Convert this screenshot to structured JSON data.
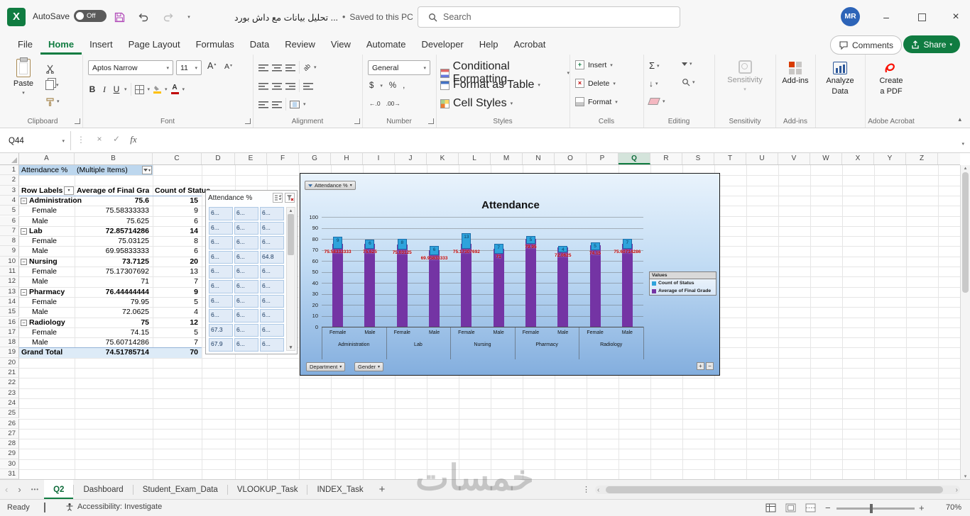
{
  "titlebar": {
    "autosave_label": "AutoSave",
    "autosave_state": "Off",
    "doc_title": "تحليل بيانات مع داش بورد ...",
    "saved_status": "Saved to this PC",
    "search_placeholder": "Search",
    "avatar": "MR"
  },
  "ribbon_tabs": {
    "items": [
      "File",
      "Home",
      "Insert",
      "Page Layout",
      "Formulas",
      "Data",
      "Review",
      "View",
      "Automate",
      "Developer",
      "Help",
      "Acrobat"
    ],
    "active": "Home",
    "comments_label": "Comments",
    "share_label": "Share"
  },
  "ribbon": {
    "paste_label": "Paste",
    "font_name": "Aptos Narrow",
    "font_size": "11",
    "number_format": "General",
    "styles_buttons": [
      "Conditional Formatting",
      "Format as Table",
      "Cell Styles"
    ],
    "cells_buttons": [
      "Insert",
      "Delete",
      "Format"
    ],
    "big_buttons": {
      "sensitivity": "Sensitivity",
      "addins": "Add-ins",
      "analyze_line1": "Analyze",
      "analyze_line2": "Data",
      "pdf_line1": "Create",
      "pdf_line2": "a PDF"
    },
    "group_labels": [
      "Clipboard",
      "Font",
      "Alignment",
      "Number",
      "Styles",
      "Cells",
      "Editing",
      "Sensitivity",
      "Add-ins",
      "Adobe Acrobat"
    ]
  },
  "formula_bar": {
    "name_box": "Q44",
    "fx_label": "fx",
    "value": ""
  },
  "columns": {
    "letters": [
      "A",
      "B",
      "C",
      "D",
      "E",
      "F",
      "G",
      "H",
      "I",
      "J",
      "K",
      "L",
      "M",
      "N",
      "O",
      "P",
      "Q",
      "R",
      "S",
      "T",
      "U",
      "V",
      "W",
      "X",
      "Y",
      "Z"
    ],
    "selected": "Q"
  },
  "rows": {
    "count": 31
  },
  "pivot": {
    "filter_label": "Attendance %",
    "filter_value": "(Multiple Items)",
    "headers": [
      "Row Labels",
      "Average of Final Grade",
      "Count of Status"
    ],
    "rows": [
      {
        "r": 4,
        "label": "Administration",
        "avg": "75.6",
        "count": "15",
        "bold": true,
        "btn": true
      },
      {
        "r": 5,
        "label": "Female",
        "avg": "75.58333333",
        "count": "9"
      },
      {
        "r": 6,
        "label": "Male",
        "avg": "75.625",
        "count": "6"
      },
      {
        "r": 7,
        "label": "Lab",
        "avg": "72.85714286",
        "count": "14",
        "bold": true,
        "btn": true
      },
      {
        "r": 8,
        "label": "Female",
        "avg": "75.03125",
        "count": "8"
      },
      {
        "r": 9,
        "label": "Male",
        "avg": "69.95833333",
        "count": "6"
      },
      {
        "r": 10,
        "label": "Nursing",
        "avg": "73.7125",
        "count": "20",
        "bold": true,
        "btn": true
      },
      {
        "r": 11,
        "label": "Female",
        "avg": "75.17307692",
        "count": "13"
      },
      {
        "r": 12,
        "label": "Male",
        "avg": "71",
        "count": "7"
      },
      {
        "r": 13,
        "label": "Pharmacy",
        "avg": "76.44444444",
        "count": "9",
        "bold": true,
        "btn": true
      },
      {
        "r": 14,
        "label": "Female",
        "avg": "79.95",
        "count": "5"
      },
      {
        "r": 15,
        "label": "Male",
        "avg": "72.0625",
        "count": "4"
      },
      {
        "r": 16,
        "label": "Radiology",
        "avg": "75",
        "count": "12",
        "bold": true,
        "btn": true
      },
      {
        "r": 17,
        "label": "Female",
        "avg": "74.15",
        "count": "5"
      },
      {
        "r": 18,
        "label": "Male",
        "avg": "75.60714286",
        "count": "7"
      },
      {
        "r": 19,
        "label": "Grand Total",
        "avg": "74.51785714",
        "count": "70",
        "bold": true,
        "total": true
      }
    ]
  },
  "slicer": {
    "title": "Attendance %",
    "items": [
      [
        "6...",
        "6...",
        "6..."
      ],
      [
        "6...",
        "6...",
        "6..."
      ],
      [
        "6...",
        "6...",
        "6..."
      ],
      [
        "6...",
        "6...",
        "64.8"
      ],
      [
        "6...",
        "6...",
        "6..."
      ],
      [
        "6...",
        "6...",
        "6..."
      ],
      [
        "6...",
        "6...",
        "6..."
      ],
      [
        "6...",
        "6...",
        "6..."
      ],
      [
        "67.3",
        "6...",
        "6..."
      ],
      [
        "67.9",
        "6...",
        "6..."
      ]
    ]
  },
  "chart_data": {
    "type": "bar",
    "title": "Attendance",
    "ylim": [
      0,
      100
    ],
    "ytick_step": 10,
    "groups": [
      "Administration",
      "Lab",
      "Nursing",
      "Pharmacy",
      "Radiology"
    ],
    "categories": [
      "Female",
      "Male",
      "Female",
      "Male",
      "Female",
      "Male",
      "Female",
      "Male",
      "Female",
      "Male"
    ],
    "series": [
      {
        "name": "Count of Status",
        "color": "#2EA3DC",
        "values": [
          9,
          6,
          8,
          6,
          13,
          7,
          5,
          4,
          5,
          7
        ]
      },
      {
        "name": "Average of Final Grade",
        "color": "#7434A4",
        "values": [
          75.58333333,
          75.625,
          75.03125,
          69.95833333,
          75.17307692,
          71,
          79.95,
          72.0625,
          74.15,
          75.60714286
        ]
      }
    ],
    "avg_labels": [
      "75.58333333",
      "75.625",
      "75.03125",
      "69.95833333",
      "75.17307692",
      "71",
      "79.95",
      "72.0625",
      "74.15",
      "75.60714286"
    ],
    "legend_title": "Values",
    "legend_position": "right",
    "grid": true,
    "field_buttons": {
      "top": "Attendance %",
      "bottom": [
        "Department",
        "Gender"
      ]
    }
  },
  "sheet_tabs": {
    "tabs": [
      "Q2",
      "Dashboard",
      "Student_Exam_Data",
      "VLOOKUP_Task",
      "INDEX_Task"
    ],
    "active": "Q2"
  },
  "status_bar": {
    "ready": "Ready",
    "accessibility": "Accessibility: Investigate",
    "zoom": "70%"
  },
  "watermark": "خمسات"
}
